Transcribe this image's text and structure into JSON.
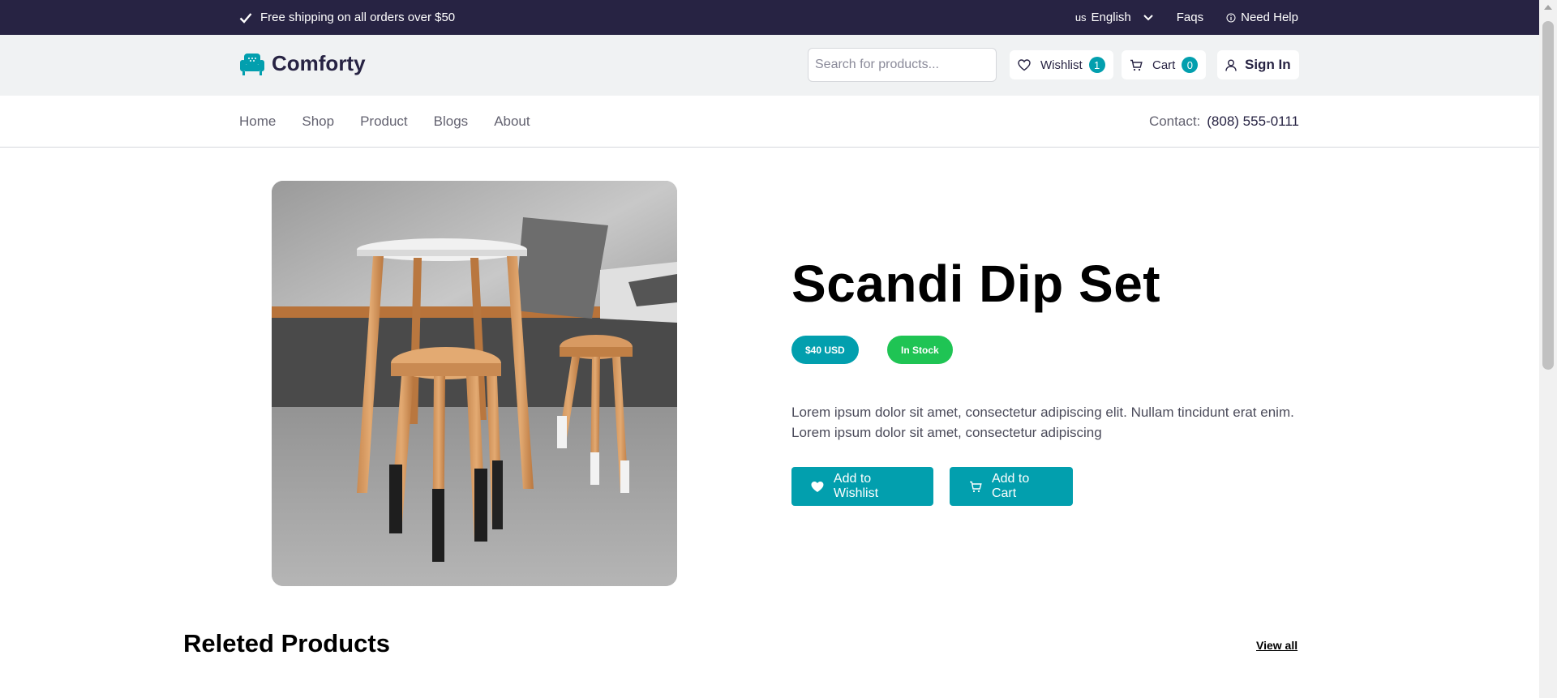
{
  "topbar": {
    "shipping_text": "Free shipping on all orders over $50",
    "lang_code": "us",
    "lang_label": "English",
    "faqs": "Faqs",
    "need_help": "Need Help"
  },
  "header": {
    "brand": "Comforty",
    "search_placeholder": "Search for products...",
    "wishlist_label": "Wishlist",
    "wishlist_count": "1",
    "cart_label": "Cart",
    "cart_count": "0",
    "signin_label": "Sign In"
  },
  "nav": {
    "items": [
      {
        "label": "Home"
      },
      {
        "label": "Shop"
      },
      {
        "label": "Product"
      },
      {
        "label": "Blogs"
      },
      {
        "label": "About"
      }
    ],
    "contact_label": "Contact:",
    "contact_number": "(808) 555-0111"
  },
  "product": {
    "title": "Scandi Dip Set",
    "price": "$40 USD",
    "stock": "In Stock",
    "description": "Lorem ipsum dolor sit amet, consectetur adipiscing elit. Nullam tincidunt erat enim. Lorem ipsum dolor sit amet, consectetur adipiscing",
    "wishlist_button": "Add to Wishlist",
    "cart_button": "Add to Cart"
  },
  "related": {
    "heading": "Releted Products",
    "view_all": "View all"
  },
  "colors": {
    "primary": "#029fae",
    "dark": "#272343",
    "success": "#1fc454"
  }
}
